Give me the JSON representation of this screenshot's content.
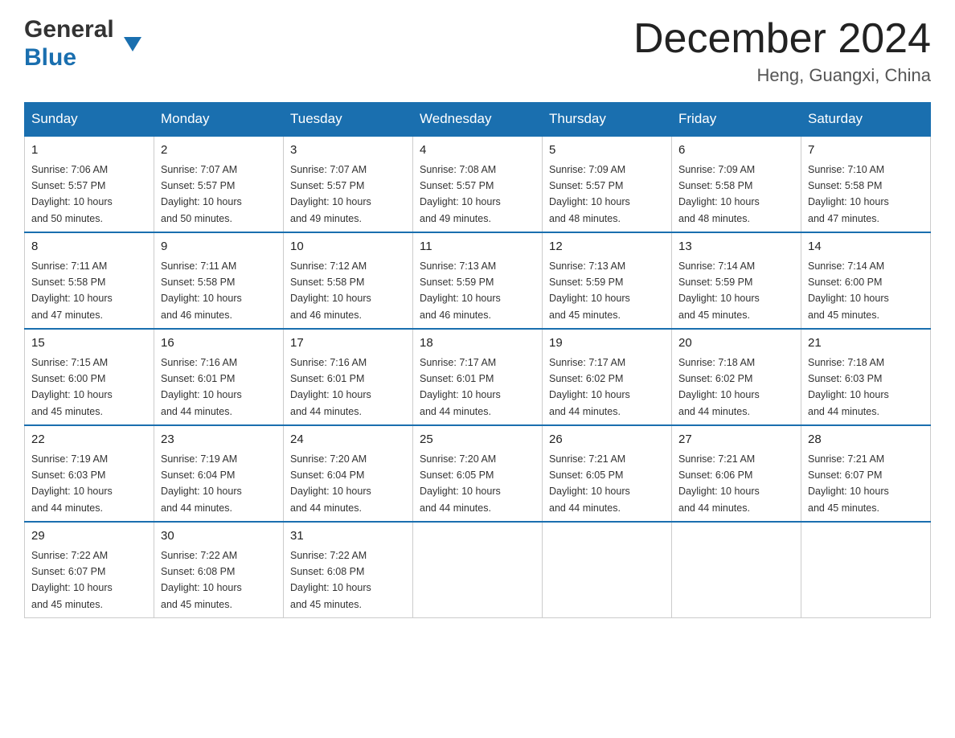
{
  "header": {
    "logo": {
      "general": "General",
      "blue": "Blue",
      "triangle": "▼"
    },
    "title": "December 2024",
    "location": "Heng, Guangxi, China"
  },
  "weekdays": [
    "Sunday",
    "Monday",
    "Tuesday",
    "Wednesday",
    "Thursday",
    "Friday",
    "Saturday"
  ],
  "weeks": [
    [
      {
        "day": "1",
        "sunrise": "7:06 AM",
        "sunset": "5:57 PM",
        "daylight": "10 hours and 50 minutes."
      },
      {
        "day": "2",
        "sunrise": "7:07 AM",
        "sunset": "5:57 PM",
        "daylight": "10 hours and 50 minutes."
      },
      {
        "day": "3",
        "sunrise": "7:07 AM",
        "sunset": "5:57 PM",
        "daylight": "10 hours and 49 minutes."
      },
      {
        "day": "4",
        "sunrise": "7:08 AM",
        "sunset": "5:57 PM",
        "daylight": "10 hours and 49 minutes."
      },
      {
        "day": "5",
        "sunrise": "7:09 AM",
        "sunset": "5:57 PM",
        "daylight": "10 hours and 48 minutes."
      },
      {
        "day": "6",
        "sunrise": "7:09 AM",
        "sunset": "5:58 PM",
        "daylight": "10 hours and 48 minutes."
      },
      {
        "day": "7",
        "sunrise": "7:10 AM",
        "sunset": "5:58 PM",
        "daylight": "10 hours and 47 minutes."
      }
    ],
    [
      {
        "day": "8",
        "sunrise": "7:11 AM",
        "sunset": "5:58 PM",
        "daylight": "10 hours and 47 minutes."
      },
      {
        "day": "9",
        "sunrise": "7:11 AM",
        "sunset": "5:58 PM",
        "daylight": "10 hours and 46 minutes."
      },
      {
        "day": "10",
        "sunrise": "7:12 AM",
        "sunset": "5:58 PM",
        "daylight": "10 hours and 46 minutes."
      },
      {
        "day": "11",
        "sunrise": "7:13 AM",
        "sunset": "5:59 PM",
        "daylight": "10 hours and 46 minutes."
      },
      {
        "day": "12",
        "sunrise": "7:13 AM",
        "sunset": "5:59 PM",
        "daylight": "10 hours and 45 minutes."
      },
      {
        "day": "13",
        "sunrise": "7:14 AM",
        "sunset": "5:59 PM",
        "daylight": "10 hours and 45 minutes."
      },
      {
        "day": "14",
        "sunrise": "7:14 AM",
        "sunset": "6:00 PM",
        "daylight": "10 hours and 45 minutes."
      }
    ],
    [
      {
        "day": "15",
        "sunrise": "7:15 AM",
        "sunset": "6:00 PM",
        "daylight": "10 hours and 45 minutes."
      },
      {
        "day": "16",
        "sunrise": "7:16 AM",
        "sunset": "6:01 PM",
        "daylight": "10 hours and 44 minutes."
      },
      {
        "day": "17",
        "sunrise": "7:16 AM",
        "sunset": "6:01 PM",
        "daylight": "10 hours and 44 minutes."
      },
      {
        "day": "18",
        "sunrise": "7:17 AM",
        "sunset": "6:01 PM",
        "daylight": "10 hours and 44 minutes."
      },
      {
        "day": "19",
        "sunrise": "7:17 AM",
        "sunset": "6:02 PM",
        "daylight": "10 hours and 44 minutes."
      },
      {
        "day": "20",
        "sunrise": "7:18 AM",
        "sunset": "6:02 PM",
        "daylight": "10 hours and 44 minutes."
      },
      {
        "day": "21",
        "sunrise": "7:18 AM",
        "sunset": "6:03 PM",
        "daylight": "10 hours and 44 minutes."
      }
    ],
    [
      {
        "day": "22",
        "sunrise": "7:19 AM",
        "sunset": "6:03 PM",
        "daylight": "10 hours and 44 minutes."
      },
      {
        "day": "23",
        "sunrise": "7:19 AM",
        "sunset": "6:04 PM",
        "daylight": "10 hours and 44 minutes."
      },
      {
        "day": "24",
        "sunrise": "7:20 AM",
        "sunset": "6:04 PM",
        "daylight": "10 hours and 44 minutes."
      },
      {
        "day": "25",
        "sunrise": "7:20 AM",
        "sunset": "6:05 PM",
        "daylight": "10 hours and 44 minutes."
      },
      {
        "day": "26",
        "sunrise": "7:21 AM",
        "sunset": "6:05 PM",
        "daylight": "10 hours and 44 minutes."
      },
      {
        "day": "27",
        "sunrise": "7:21 AM",
        "sunset": "6:06 PM",
        "daylight": "10 hours and 44 minutes."
      },
      {
        "day": "28",
        "sunrise": "7:21 AM",
        "sunset": "6:07 PM",
        "daylight": "10 hours and 45 minutes."
      }
    ],
    [
      {
        "day": "29",
        "sunrise": "7:22 AM",
        "sunset": "6:07 PM",
        "daylight": "10 hours and 45 minutes."
      },
      {
        "day": "30",
        "sunrise": "7:22 AM",
        "sunset": "6:08 PM",
        "daylight": "10 hours and 45 minutes."
      },
      {
        "day": "31",
        "sunrise": "7:22 AM",
        "sunset": "6:08 PM",
        "daylight": "10 hours and 45 minutes."
      },
      null,
      null,
      null,
      null
    ]
  ],
  "labels": {
    "sunrise": "Sunrise:",
    "sunset": "Sunset:",
    "daylight": "Daylight:"
  }
}
